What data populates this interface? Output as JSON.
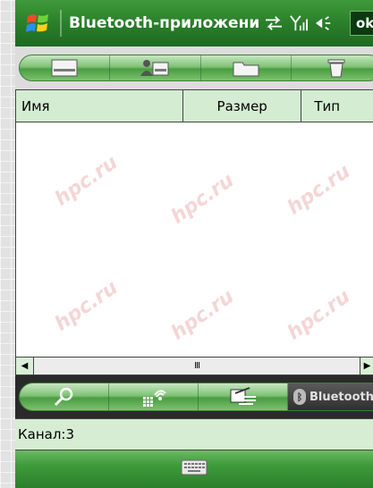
{
  "titlebar": {
    "title": "Bluetooth-приложени",
    "ok_label": "ok",
    "icons": [
      "windows-start-icon",
      "sync-arrows-icon",
      "signal-strength-icon",
      "volume-icon"
    ]
  },
  "toolbar_top": {
    "buttons": [
      "card-icon",
      "contact-icon",
      "folder-icon",
      "trash-icon"
    ]
  },
  "list": {
    "columns": [
      "Имя",
      "Размер",
      "Тип"
    ],
    "rows": []
  },
  "scrollbar": {
    "thumb_grip": "III"
  },
  "tabs": {
    "items": [
      "search-icon",
      "grid-connection-icon",
      "file-transfer-icon"
    ],
    "active_label": "Bluetooth"
  },
  "status": {
    "text": "Канал:3"
  },
  "softkeys": {
    "center": "keyboard-icon"
  },
  "watermark": "hpc.ru",
  "colors": {
    "accent_green": "#2a7f2a",
    "header_bg": "#d4ecd2",
    "ok_bg": "#0c3a10"
  }
}
